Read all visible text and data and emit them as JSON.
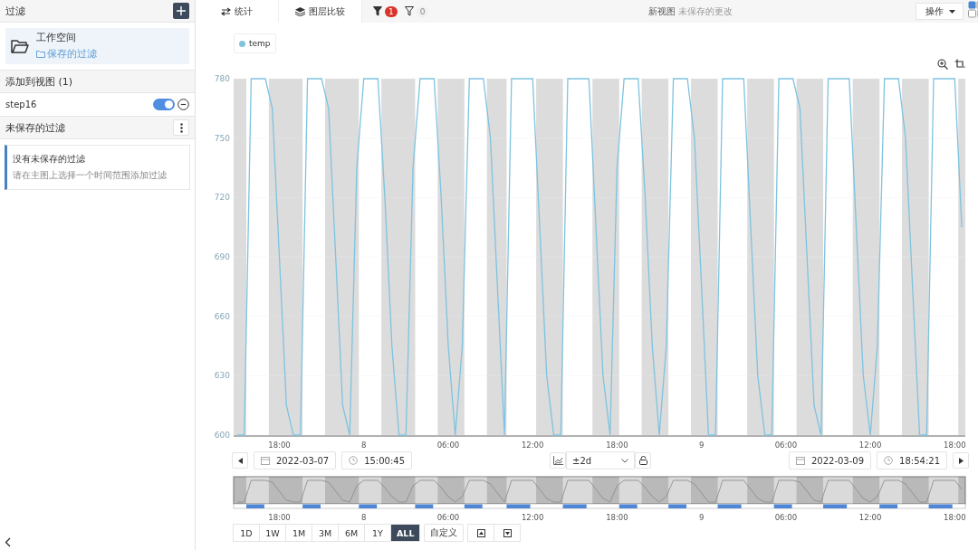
{
  "sidebar": {
    "title": "过滤",
    "workspace": {
      "title": "工作空间",
      "link": "保存的过滤"
    },
    "views_title": "添加到视图 (1)",
    "views": [
      {
        "name": "step16",
        "on": true
      }
    ],
    "unsaved_title": "未保存的过滤",
    "notice": {
      "title": "没有未保存的过滤",
      "text": "请在主图上选择一个时间范围添加过滤"
    }
  },
  "toolbar": {
    "tabs": [
      {
        "label": "统计",
        "kind": "stats"
      },
      {
        "label": "图层比较",
        "kind": "layers"
      }
    ],
    "filters": [
      {
        "kind": "active",
        "count": "1"
      },
      {
        "kind": "inactive",
        "count": "0"
      }
    ],
    "view_name": "新视图",
    "view_status": "未保存的更改",
    "action_button": "操作"
  },
  "chart": {
    "chart_data": {
      "type": "line",
      "categories": [
        null,
        null,
        null,
        null,
        null,
        null,
        "18:00",
        null,
        null,
        null,
        null,
        null,
        null,
        null,
        null,
        null,
        null,
        null,
        "8",
        null,
        null,
        null,
        null,
        null,
        null,
        null,
        null,
        null,
        null,
        null,
        "06:00",
        null,
        null,
        null,
        null,
        null,
        null,
        null,
        null,
        null,
        null,
        null,
        "12:00",
        null,
        null,
        null,
        null,
        null,
        null,
        null,
        null,
        null,
        null,
        null,
        "18:00",
        null,
        null,
        null,
        null,
        null,
        null,
        null,
        null,
        null,
        null,
        null,
        "9",
        null,
        null,
        null,
        null,
        null,
        null,
        null,
        null,
        null,
        null,
        null,
        "06:00",
        null,
        null,
        null,
        null,
        null,
        null,
        null,
        null,
        null,
        null,
        null,
        "12:00",
        null,
        null,
        null,
        null,
        null,
        null,
        null,
        null,
        null,
        null,
        null,
        "18:00",
        null
      ],
      "series": [
        {
          "name": "temp",
          "color": "#7ec3e0",
          "values": [
            600,
            600,
            780,
            780,
            780,
            765,
            690,
            615,
            600,
            600,
            780,
            780,
            780,
            765,
            690,
            615,
            600,
            735,
            780,
            780,
            780,
            720,
            645,
            600,
            600,
            735,
            780,
            780,
            780,
            720,
            645,
            600,
            645,
            780,
            780,
            780,
            750,
            675,
            600,
            780,
            780,
            780,
            780,
            705,
            630,
            600,
            600,
            780,
            780,
            780,
            780,
            705,
            630,
            600,
            735,
            780,
            780,
            780,
            720,
            645,
            600,
            645,
            780,
            780,
            780,
            750,
            675,
            600,
            600,
            780,
            780,
            780,
            780,
            705,
            630,
            600,
            600,
            780,
            780,
            780,
            765,
            690,
            615,
            600,
            780,
            780,
            780,
            780,
            705,
            630,
            600,
            645,
            780,
            780,
            780,
            750,
            675,
            600,
            600,
            780,
            780,
            780,
            780,
            705
          ]
        }
      ],
      "grid": true,
      "ylim": [
        600,
        780
      ],
      "yticks": [
        600,
        630,
        660,
        690,
        720,
        750,
        780
      ]
    }
  },
  "navigator": {
    "start_date": "2022-03-07",
    "start_time": "15:00:45",
    "range": "±2d",
    "end_date": "2022-03-09",
    "end_time": "18:54:21",
    "ticks": [
      "18:00",
      "8",
      "06:00",
      "12:00",
      "18:00",
      "9",
      "06:00",
      "12:00",
      "18:00"
    ]
  },
  "range_buttons": [
    {
      "label": "1D",
      "selected": false
    },
    {
      "label": "1W",
      "selected": false
    },
    {
      "label": "1M",
      "selected": false
    },
    {
      "label": "3M",
      "selected": false
    },
    {
      "label": "6M",
      "selected": false
    },
    {
      "label": "1Y",
      "selected": false
    },
    {
      "label": "ALL",
      "selected": true
    }
  ],
  "custom_button": "自定义"
}
